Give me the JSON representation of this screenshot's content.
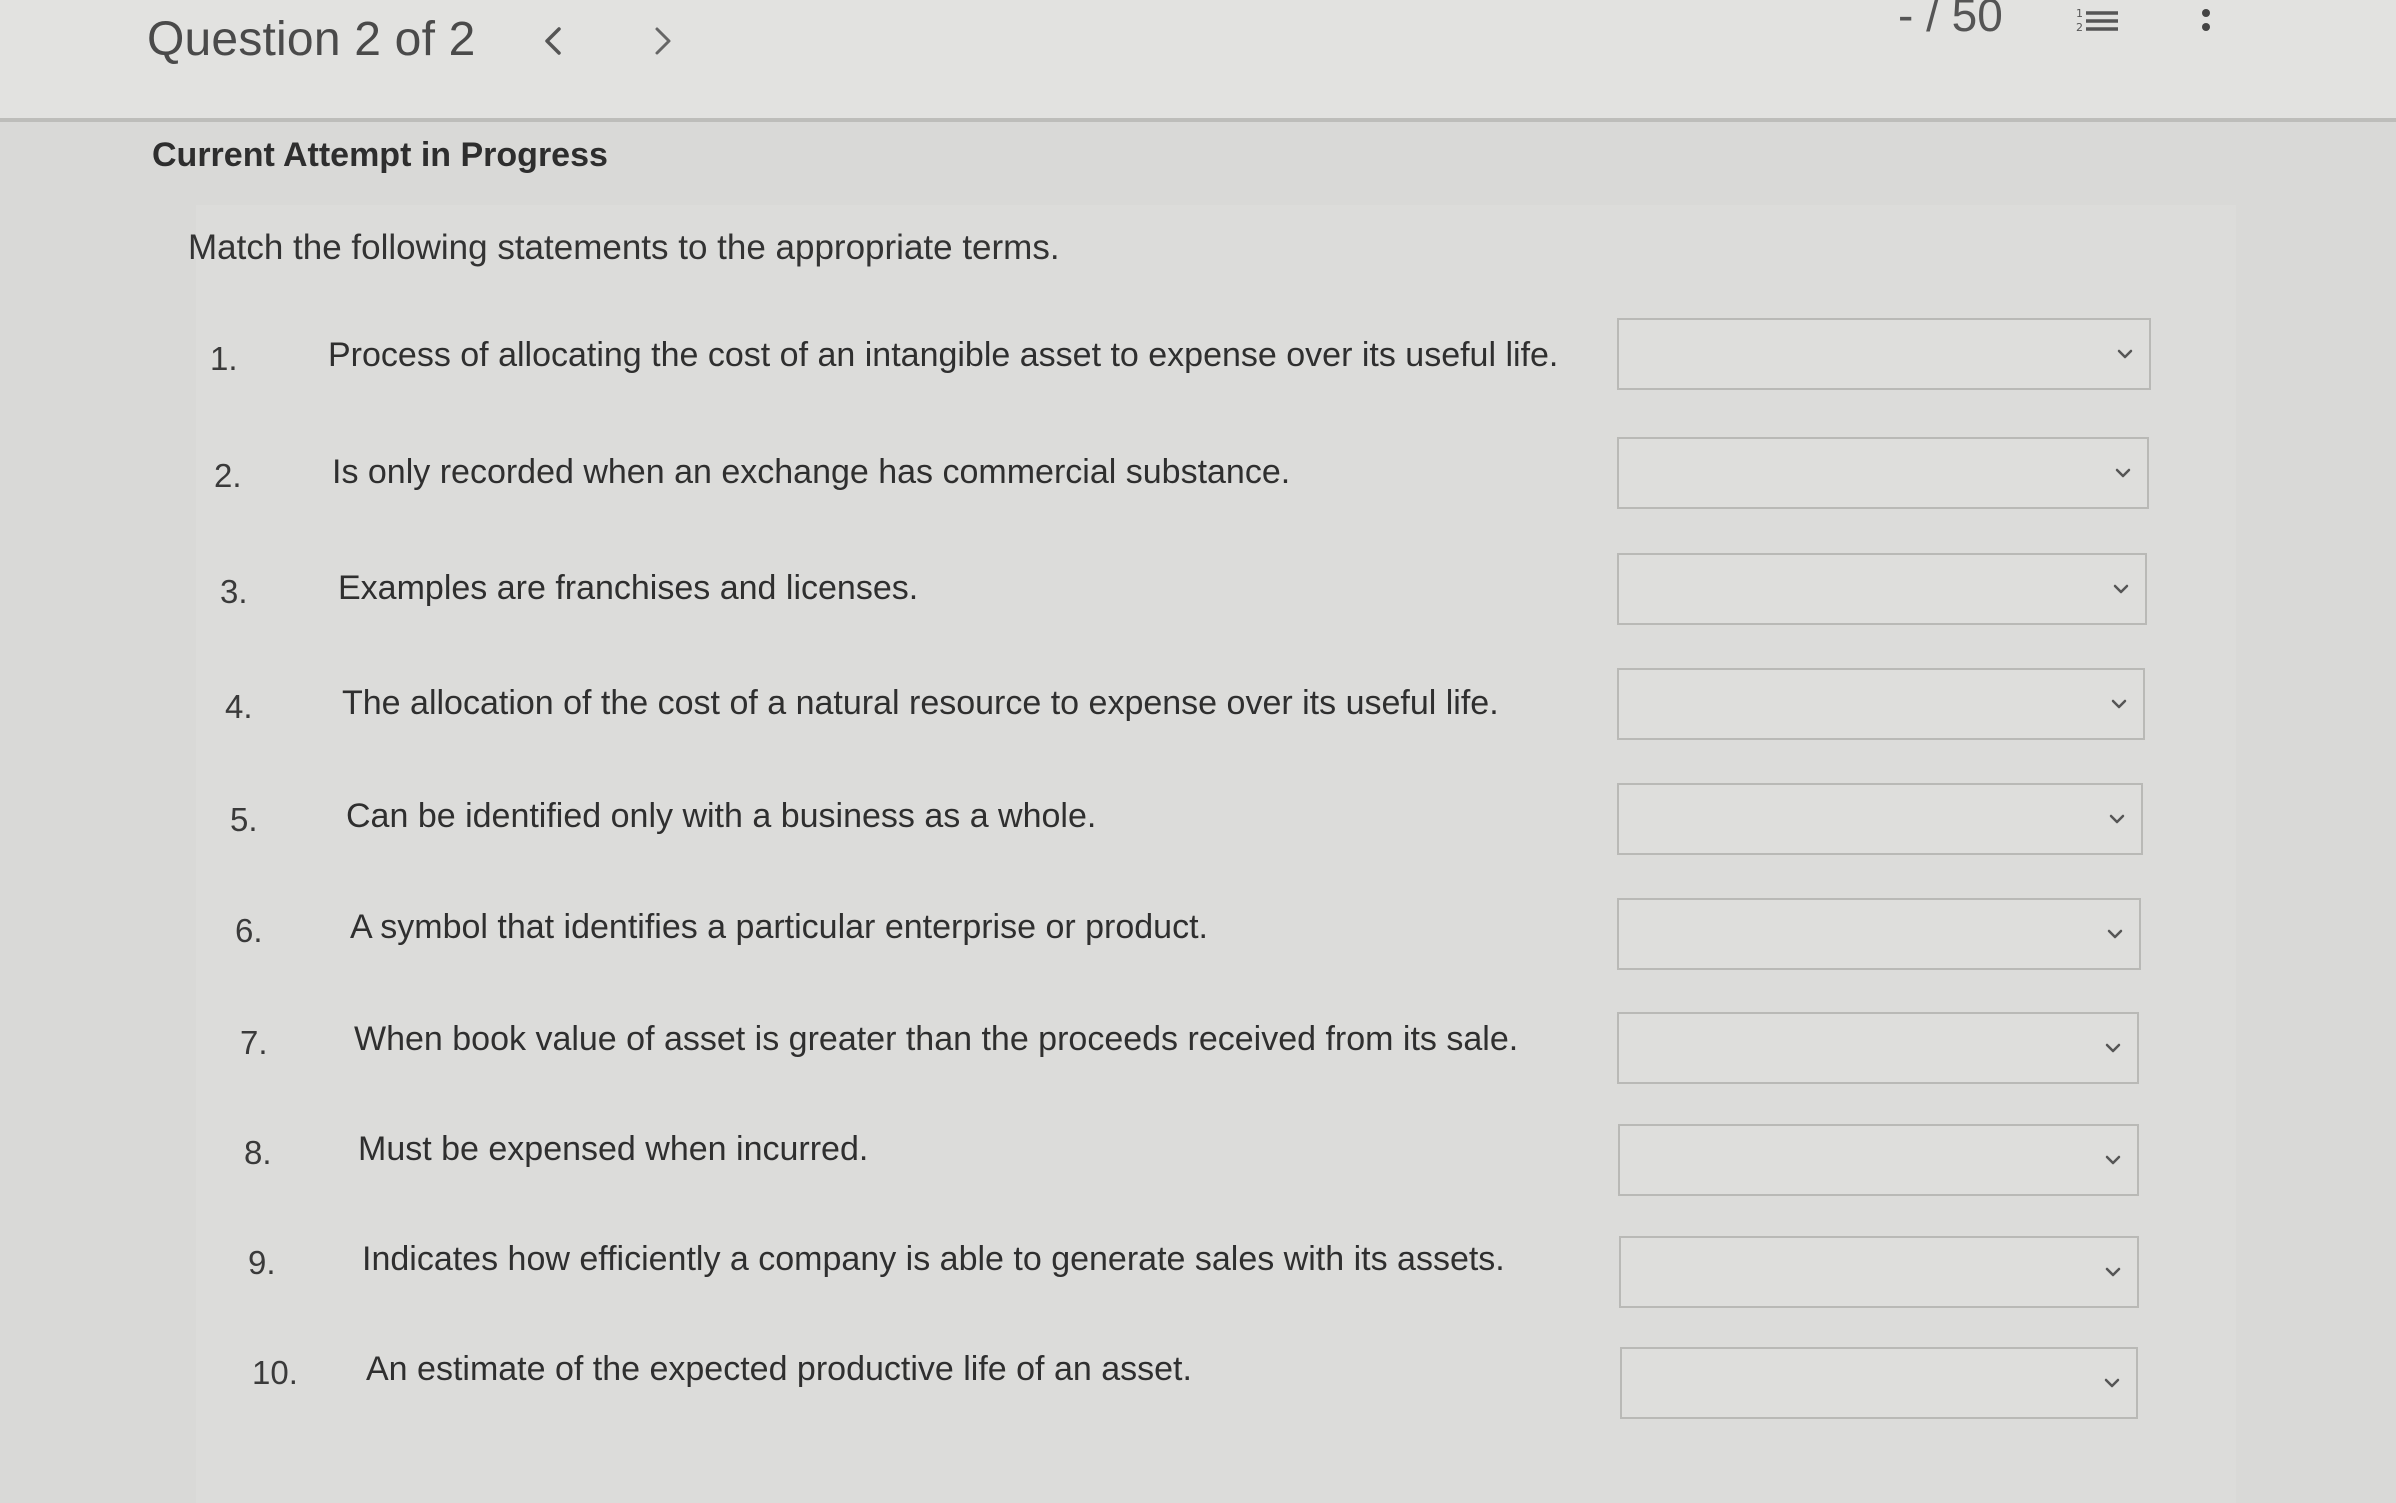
{
  "header": {
    "question_label": "Question 2 of 2",
    "score": "- / 50"
  },
  "attempt_label": "Current Attempt in Progress",
  "instructions": "Match the following statements to the appropriate terms.",
  "items": [
    {
      "number": "1.",
      "statement": "Process of allocating the cost of an intangible asset to expense over its useful life.",
      "selected": ""
    },
    {
      "number": "2.",
      "statement": "Is only recorded when an exchange has commercial substance.",
      "selected": ""
    },
    {
      "number": "3.",
      "statement": "Examples are franchises and licenses.",
      "selected": ""
    },
    {
      "number": "4.",
      "statement": "The allocation of the cost of a natural resource to expense over its useful life.",
      "selected": ""
    },
    {
      "number": "5.",
      "statement": "Can be identified only with a business as a whole.",
      "selected": ""
    },
    {
      "number": "6.",
      "statement": "A symbol that identifies a particular enterprise or product.",
      "selected": ""
    },
    {
      "number": "7.",
      "statement": "When book value of asset is greater than the proceeds received from its sale.",
      "selected": ""
    },
    {
      "number": "8.",
      "statement": "Must be expensed when incurred.",
      "selected": ""
    },
    {
      "number": "9.",
      "statement": "Indicates how efficiently a company is able to generate sales with its assets.",
      "selected": ""
    },
    {
      "number": "10.",
      "statement": "An estimate of the expected productive life of an asset.",
      "selected": ""
    }
  ],
  "icons": {
    "prev": "chevron-left-icon",
    "next": "chevron-right-icon",
    "list": "question-list-icon",
    "more": "more-vertical-icon",
    "dropdown": "chevron-down-icon"
  }
}
